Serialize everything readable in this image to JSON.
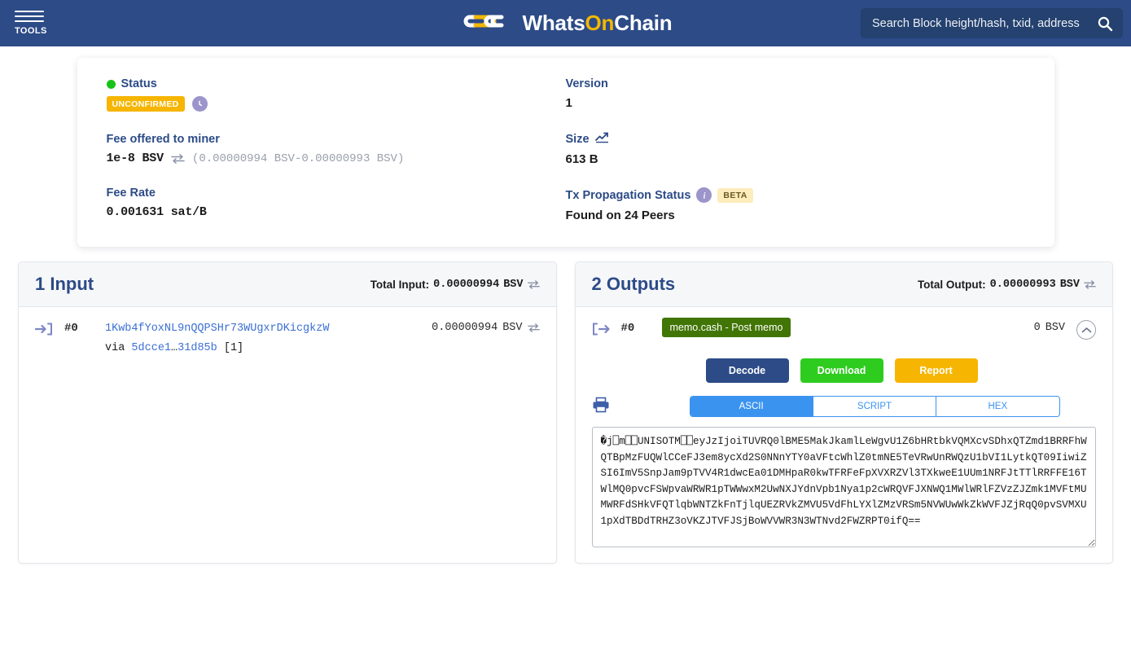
{
  "header": {
    "tools_label": "TOOLS",
    "brand_part1": "Whats",
    "brand_accent": "On",
    "brand_part2": "Chain",
    "search_placeholder": "Search Block height/hash, txid, address",
    "search_value": "",
    "bg_color": "#2c4b87",
    "accent_color": "#f2b705"
  },
  "summary": {
    "status_label": "Status",
    "status_badge": "UNCONFIRMED",
    "status_badge_color": "#f6b500",
    "status_dot_color": "#17c317",
    "fee_label": "Fee offered to miner",
    "fee_value": "1e-8 BSV",
    "fee_range": "(0.00000994 BSV-0.00000993 BSV)",
    "fee_rate_label": "Fee Rate",
    "fee_rate_value": "0.001631 sat/B",
    "version_label": "Version",
    "version_value": "1",
    "size_label": "Size",
    "size_value": "613 B",
    "propagation_label": "Tx Propagation Status",
    "propagation_badge": "BETA",
    "propagation_value": "Found on 24 Peers"
  },
  "inputs": {
    "title": "1 Input",
    "total_label": "Total Input:",
    "total_value": "0.00000994",
    "total_unit": "BSV",
    "rows": [
      {
        "index": "#0",
        "address": "1Kwb4fYoxNL9nQQPSHr73WUgxrDKicgkzW",
        "via_label": "via",
        "via_from": "5dcce1",
        "via_sep": "…",
        "via_to": "31d85b",
        "via_index": "[1]",
        "amount": "0.00000994",
        "unit": "BSV"
      }
    ]
  },
  "outputs": {
    "title": "2 Outputs",
    "total_label": "Total Output:",
    "total_value": "0.00000993",
    "total_unit": "BSV",
    "row": {
      "index": "#0",
      "type_badge": "memo.cash - Post memo",
      "type_badge_color": "#417505",
      "amount": "0",
      "unit": "BSV"
    },
    "buttons": {
      "decode": "Decode",
      "download": "Download",
      "report": "Report",
      "decode_color": "#2c4b87",
      "download_color": "#2ecc1f",
      "report_color": "#f6b500"
    },
    "tabs": [
      {
        "label": "ASCII",
        "active": true
      },
      {
        "label": "SCRIPT",
        "active": false
      },
      {
        "label": "HEX",
        "active": false
      }
    ],
    "script_text": "�j⎕m⎕⎕UNISOTM⎕⎕eyJzIjoiTUVRQ0lBME5MakJkamlLeWgvU1Z6bHRtbkVQMXcvSDhxQTZmd1BRRFhWQTBpMzFUQWlCCeFJ3em8ycXd2S0NNnYTY0aVFtcWhlZ0tmNE5TeVRwUnRWQzU1bVI1LytkQT09IiwiZSI6ImV5SnpJam9pTVV4R1dwcEa01DMHpaR0kwTFRFeFpXVXRZVl3TXkweE1UUm1NRFJtTTlRRFFE16TWlMQ0pvcFSWpvaWRWR1pTWWwxM2UwNXJYdnVpb1Nya1p2cWRQVFJXNWQ1MWlWRlFZVzZJZmk1MVFtMUMWRFdSHkVFQTlqbWNTZkFnTjlqUEZRVkZMVU5VdFhLYXlZMzVRSm5NVWUwWkZkWVFJZjRqQ0pvSVMXU1pXdTBDdTRHZ3oVKZJTVFJSjBoWVVWR3N3WTNvd2FWZRPT0ifQ=="
  }
}
